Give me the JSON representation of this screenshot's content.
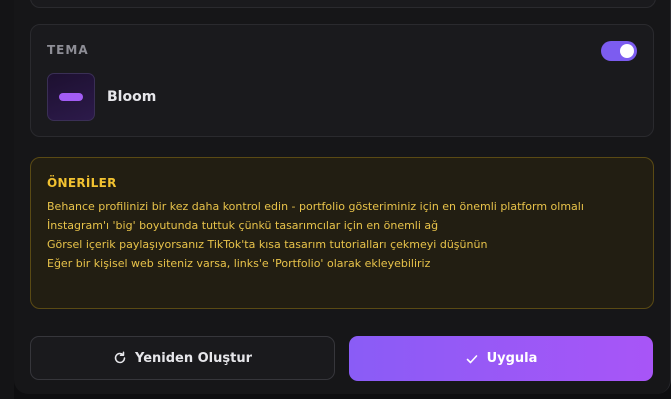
{
  "theme": {
    "section_title": "TEMA",
    "enabled": true,
    "selected_name": "Bloom",
    "accent_color": "#a25cf5"
  },
  "suggestions": {
    "title": "ÖNERİLER",
    "items": [
      "Behance profilinizi bir kez daha kontrol edin - portfolio gösteriminiz için en önemli platform olmalı",
      "İnstagram'ı 'big' boyutunda tuttuk çünkü tasarımcılar için en önemli ağ",
      "Görsel içerik paylaşıyorsanız TikTok'ta kısa tasarım tutorialları çekmeyi düşünün",
      "Eğer bir kişisel web siteniz varsa, links'e 'Portfolio' olarak ekleyebiliriz"
    ],
    "color": "#f2c230"
  },
  "actions": {
    "regenerate_label": "Yeniden Oluştur",
    "apply_label": "Uygula",
    "apply_color": "#8a5cf6"
  },
  "icons": {
    "regenerate": "refresh-icon",
    "apply": "check-icon"
  }
}
